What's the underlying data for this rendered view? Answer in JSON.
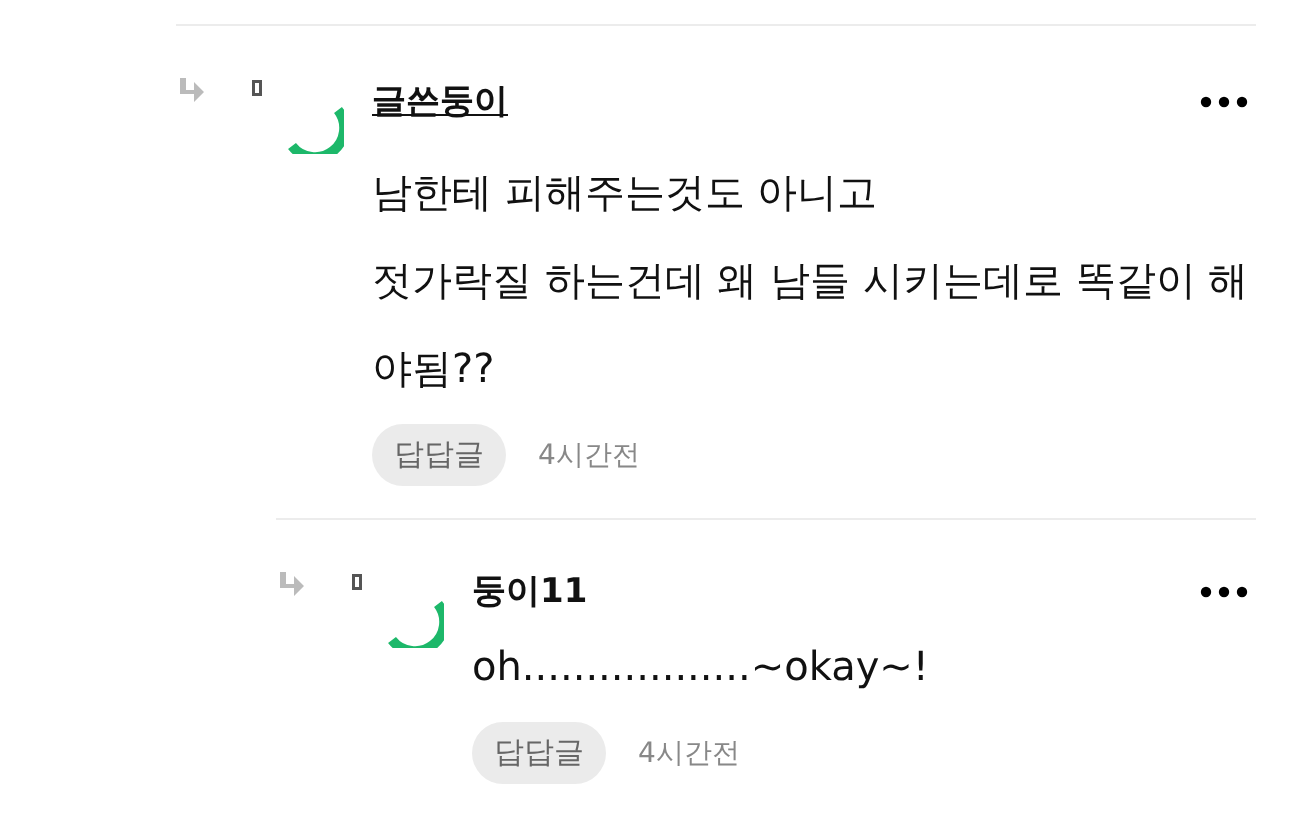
{
  "comments": [
    {
      "author": "글쓴둥이",
      "is_writer": true,
      "lines": [
        "남한테 피해주는것도 아니고",
        "젓가락질 하는건데 왜 남들 시키는데로 똑같이 해",
        "야됨??"
      ],
      "tag": "답답글",
      "time": "4시간전",
      "children": [
        {
          "author": "둥이11",
          "is_writer": false,
          "lines": [
            "oh..................~okay~!"
          ],
          "tag": "답답글",
          "time": "4시간전"
        }
      ]
    }
  ]
}
